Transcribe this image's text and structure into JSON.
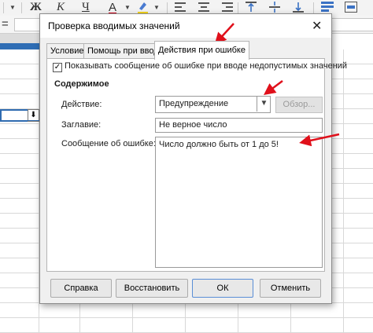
{
  "toolbar": {
    "bold": "Ж",
    "italic": "К",
    "underline": "Ч",
    "font_color_letter": "A",
    "accent_red": "#d0021b"
  },
  "formula": {
    "equals": "="
  },
  "cell": {
    "dropdown_glyph": "⬇"
  },
  "dialog": {
    "title": "Проверка вводимых значений",
    "close_glyph": "✕",
    "tabs": [
      {
        "label": "Условие"
      },
      {
        "label": "Помощь при вводе"
      },
      {
        "label": "Действия при ошибке"
      }
    ],
    "active_tab": 2,
    "show_error_checked": true,
    "show_error_label": "Показывать сообщение об ошибке при вводе недопустимых значений",
    "section_title": "Содержимое",
    "action_label": "Действие:",
    "action_value": "Предупреждение",
    "browse_label": "Обзор...",
    "title_label": "Заглавие:",
    "title_value": "Не верное число",
    "message_label": "Сообщение об ошибке:",
    "message_value": "Число должно быть от 1 до 5!",
    "buttons": {
      "help": "Справка",
      "reset": "Восстановить",
      "ok": "ОК",
      "cancel": "Отменить"
    }
  },
  "annotation_color": "#e0101b"
}
